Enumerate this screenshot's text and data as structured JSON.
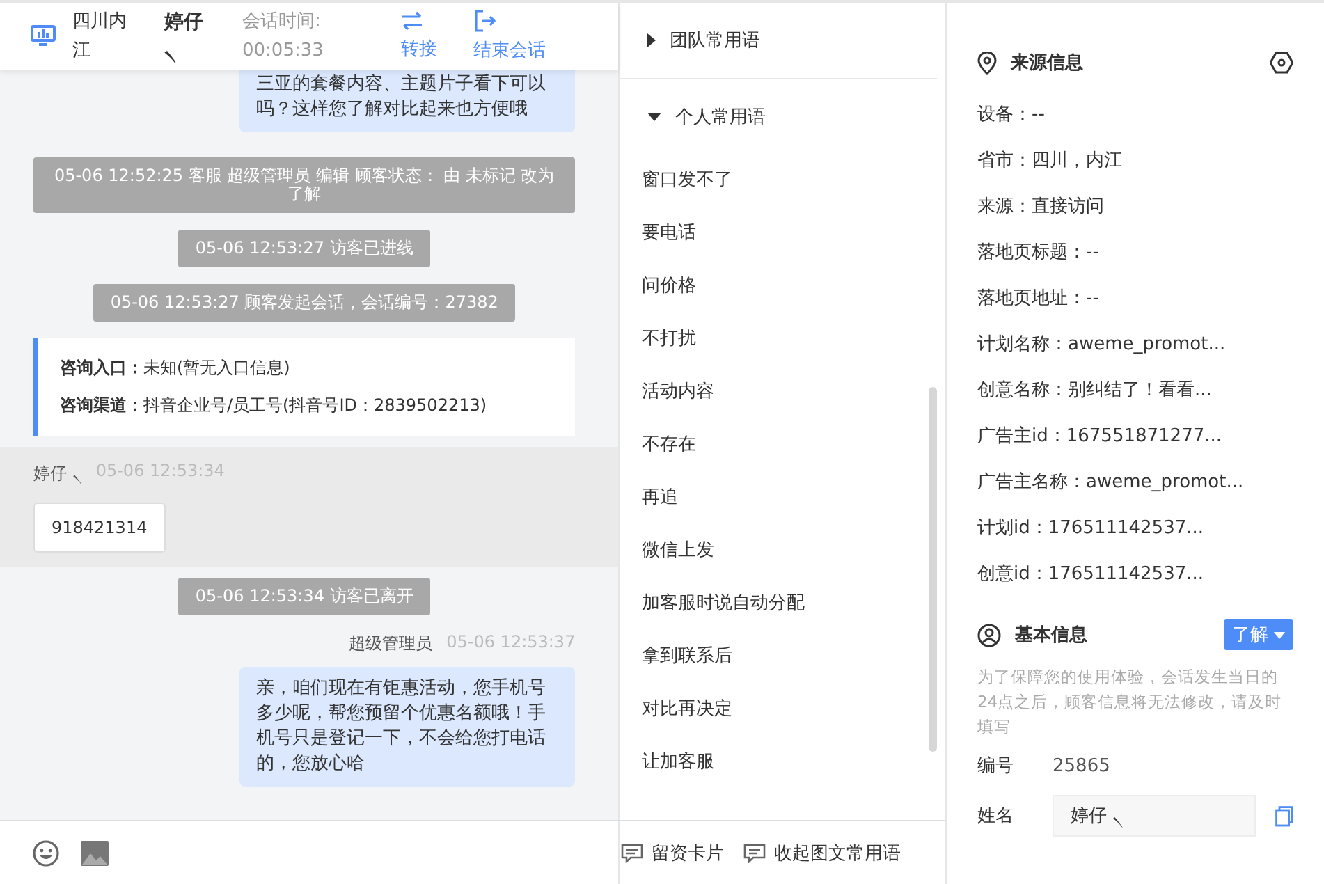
{
  "header": {
    "location": "四川内江",
    "visitor": "婷仔 ৲",
    "timer_label": "会话时间:",
    "timer": "00:05:33",
    "actions": [
      {
        "kind": "transfer",
        "label": "转接"
      },
      {
        "kind": "end",
        "label": "结束会话"
      }
    ]
  },
  "messages": [
    {
      "kind": "agent",
      "text": "三亚的套餐内容、主题片子看下可以吗？这样您了解对比起来也方便哦"
    },
    {
      "kind": "system",
      "text": "05-06 12:52:25 客服 超级管理员 编辑 顾客状态： 由 未标记 改为了解"
    },
    {
      "kind": "system",
      "text": "05-06 12:53:27 访客已进线"
    },
    {
      "kind": "system",
      "text": "05-06 12:53:27 顾客发起会话，会话编号：27382"
    },
    {
      "kind": "info",
      "rows": [
        {
          "label": "咨询入口：",
          "value": "未知(暂无入口信息)"
        },
        {
          "label": "咨询渠道：",
          "value": "抖音企业号/员工号(抖音号ID：2839502213)"
        }
      ]
    },
    {
      "kind": "visitor",
      "name": "婷仔 ৲",
      "time": "05-06 12:53:34",
      "text": "918421314"
    },
    {
      "kind": "system",
      "text": "05-06 12:53:34 访客已离开"
    },
    {
      "kind": "agent",
      "name": "超级管理员",
      "time": "05-06 12:53:37",
      "text": "亲，咱们现在有钜惠活动，您手机号多少呢，帮您预留个优惠名额哦！手机号只是登记一下，不会给您打电话的，您放心哈"
    }
  ],
  "phrases": {
    "groups": [
      {
        "label": "团队常用语",
        "expanded": false
      },
      {
        "label": "个人常用语",
        "expanded": true
      }
    ],
    "items": [
      "窗口发不了",
      "要电话",
      "问价格",
      "不打扰",
      "活动内容",
      "不存在",
      "再追",
      "微信上发",
      "加客服时说自动分配",
      "拿到联系后",
      "对比再决定",
      "让加客服"
    ]
  },
  "toolbar": [
    "留资卡片",
    "收起图文常用语"
  ],
  "source_info": {
    "title": "来源信息",
    "rows": [
      "设备：--",
      "省市：四川，内江",
      "来源：直接访问",
      "落地页标题：--",
      "落地页地址：--",
      "计划名称：aweme_promot...",
      "创意名称：别纠结了！看看...",
      "广告主id：167551871277...",
      "广告主名称：aweme_promot...",
      "计划id：176511142537...",
      "创意id：176511142537..."
    ]
  },
  "basic_info": {
    "title": "基本信息",
    "status": "了解",
    "notice": "为了保障您的使用体验，会话发生当日的24点之后，顾客信息将无法修改，请及时填写",
    "fields": [
      {
        "kind": "text",
        "label": "编号",
        "value": "25865"
      },
      {
        "kind": "input",
        "label": "姓名",
        "value": "婷仔 ৲"
      }
    ]
  }
}
